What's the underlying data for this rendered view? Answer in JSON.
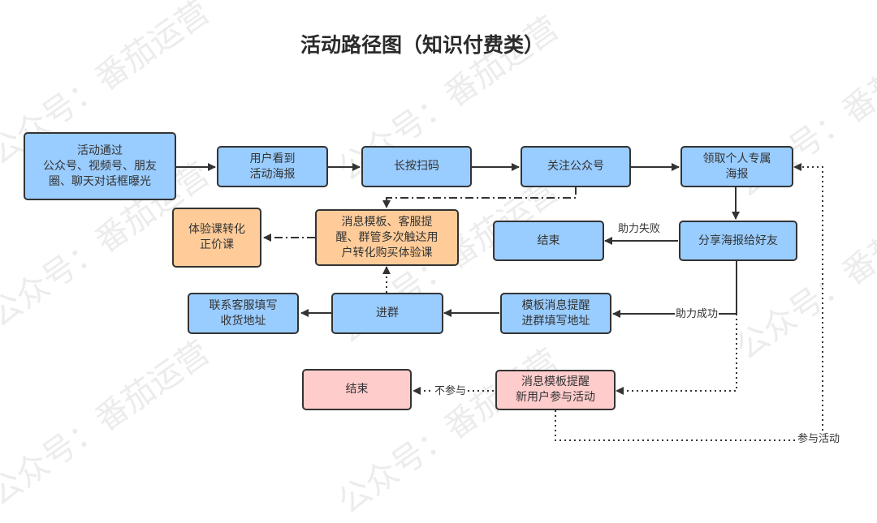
{
  "title": "活动路径图（知识付费类）",
  "watermarks": [
    "公众号：番茄运营",
    "公众号：番茄运营",
    "公众号：番茄运营",
    "公众号：番茄运营",
    "公众号：番茄运营",
    "公众号：番茄运营",
    "公众号：番茄运营",
    "公众号：番茄运营"
  ],
  "colors": {
    "blue_fill": "#99ccff",
    "orange_fill": "#ffcc99",
    "pink_fill": "#ffcccc",
    "stroke": "#333333"
  },
  "nodes": {
    "exposure": "活动通过\n公众号、视频号、朋友\n圈、聊天对话框曝光",
    "see_poster": "用户看到\n活动海报",
    "scan": "长按扫码",
    "follow": "关注公众号",
    "get_poster": "领取个人专属\n海报",
    "touch": "消息模板、客服提\n醒、群管多次触达用\n户转化购买体验课",
    "convert": "体验课转化\n正价课",
    "end_fail": "结束",
    "share": "分享海报给好友",
    "contact_cs": "联系客服填写\n收货地址",
    "join_group": "进群",
    "template_msg": "模板消息提醒\n进群填写地址",
    "end_no": "结束",
    "new_user_msg": "消息模板提醒\n新用户参与活动"
  },
  "edge_labels": {
    "fail": "助力失败",
    "success": "助力成功",
    "no_join": "不参与",
    "join": "参与活动"
  }
}
